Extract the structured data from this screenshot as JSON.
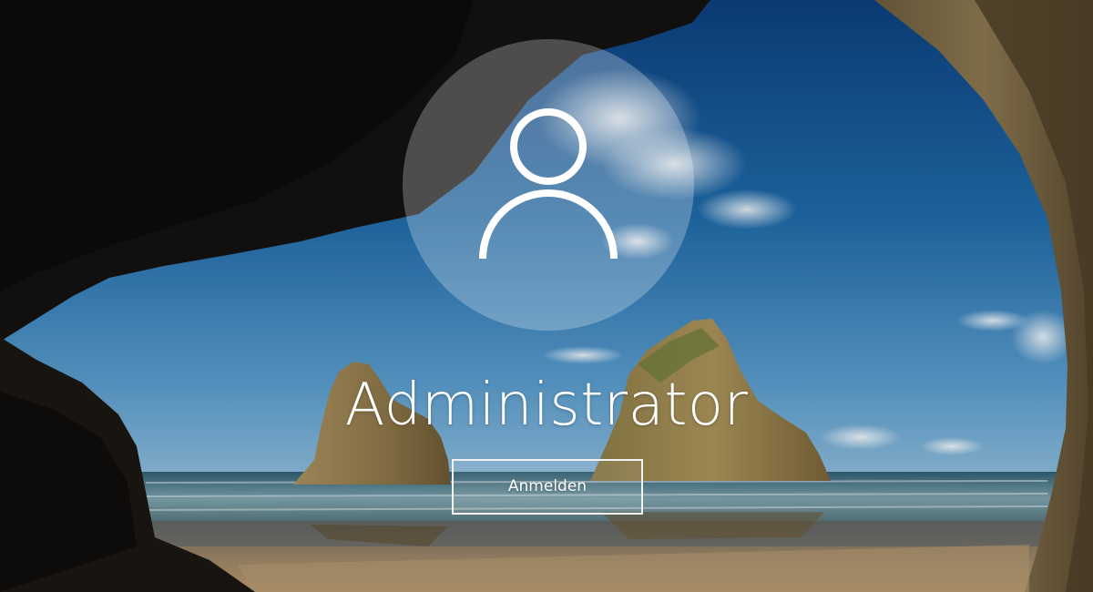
{
  "lock_screen": {
    "avatar_icon": "user-icon",
    "username": "Administrator",
    "sign_in_label": "Anmelden"
  },
  "colors": {
    "text": "#ffffff",
    "button_border": "#f2f2f2"
  }
}
